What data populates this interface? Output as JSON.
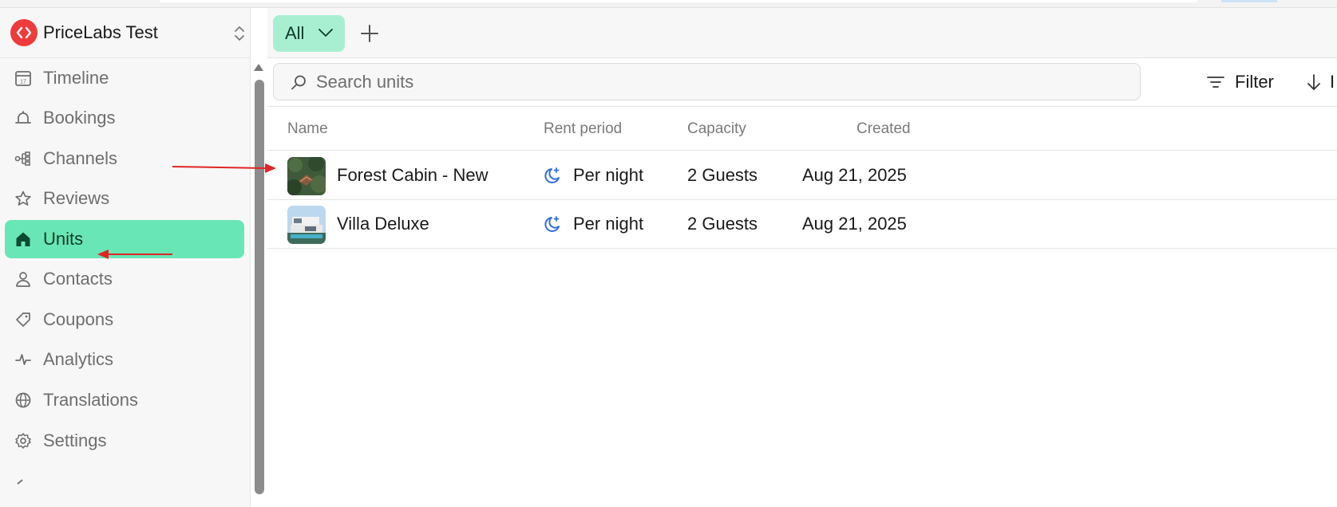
{
  "workspace": {
    "name": "PriceLabs Test"
  },
  "sidebar": {
    "items": [
      {
        "label": "Timeline",
        "icon": "calendar-icon"
      },
      {
        "label": "Bookings",
        "icon": "bell-icon"
      },
      {
        "label": "Channels",
        "icon": "channels-icon"
      },
      {
        "label": "Reviews",
        "icon": "star-icon"
      },
      {
        "label": "Units",
        "icon": "home-icon",
        "active": true
      },
      {
        "label": "Contacts",
        "icon": "person-icon"
      },
      {
        "label": "Coupons",
        "icon": "tag-icon"
      },
      {
        "label": "Analytics",
        "icon": "pulse-icon"
      },
      {
        "label": "Translations",
        "icon": "globe-icon"
      },
      {
        "label": "Settings",
        "icon": "gear-icon"
      }
    ]
  },
  "views": {
    "active_label": "All"
  },
  "search": {
    "placeholder": "Search units"
  },
  "toolbar": {
    "filter_label": "Filter",
    "sort_label": "I"
  },
  "table": {
    "columns": [
      "Name",
      "Rent period",
      "Capacity",
      "Created"
    ],
    "rows": [
      {
        "name": "Forest Cabin - New",
        "rent_period": "Per night",
        "capacity": "2 Guests",
        "created": "Aug 21, 2025"
      },
      {
        "name": "Villa Deluxe",
        "rent_period": "Per night",
        "capacity": "2 Guests",
        "created": "Aug 21, 2025"
      }
    ]
  },
  "colors": {
    "active_nav": "#69e6b6",
    "view_chip": "#a8efd2",
    "brand": "#ee3b3b",
    "annotation_arrow": "#e02424",
    "rent_icon": "#2f6fe0"
  }
}
